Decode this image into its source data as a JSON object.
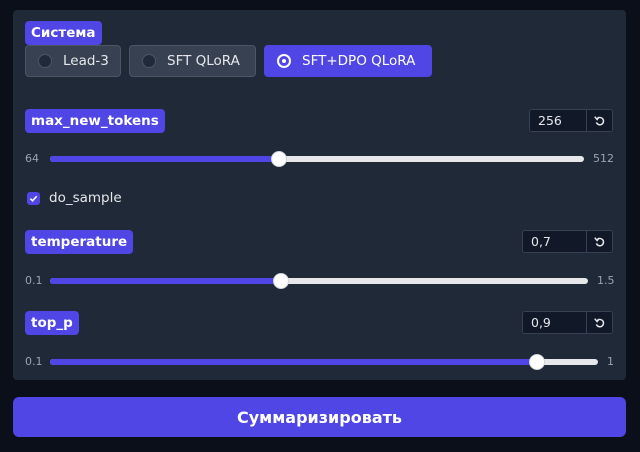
{
  "system": {
    "label": "Система",
    "options": [
      {
        "label": "Lead-3",
        "selected": false
      },
      {
        "label": "SFT QLoRA",
        "selected": false
      },
      {
        "label": "SFT+DPO QLoRA",
        "selected": true
      }
    ]
  },
  "max_new_tokens": {
    "label": "max_new_tokens",
    "value": "256",
    "min": "64",
    "max": "512",
    "fraction": 0.429
  },
  "do_sample": {
    "label": "do_sample",
    "checked": true
  },
  "temperature": {
    "label": "temperature",
    "value": "0,7",
    "min": "0.1",
    "max": "1.5",
    "fraction": 0.429
  },
  "top_p": {
    "label": "top_p",
    "value": "0,9",
    "min": "0.1",
    "max": "1",
    "fraction": 0.889
  },
  "submit": {
    "label": "Суммаризировать"
  },
  "colors": {
    "accent": "#4f46e5",
    "panel": "#1f2937",
    "background": "#0b0f19"
  },
  "icons": {
    "reset": "reset-icon",
    "check": "check-icon"
  }
}
